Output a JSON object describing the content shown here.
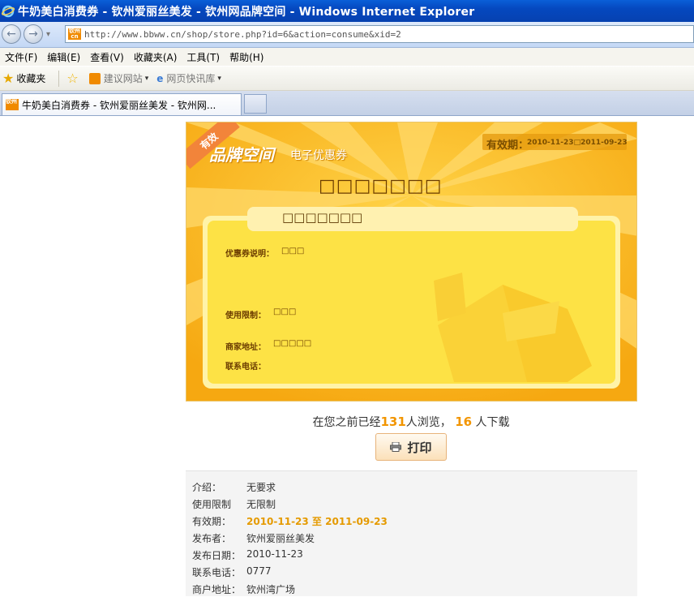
{
  "window": {
    "title": "牛奶美白消费券 - 钦州爱丽丝美发 - 钦州网品牌空间 - Windows Internet Explorer"
  },
  "address_bar": {
    "favicon_text": "钦州 cn",
    "url": "http://www.bbww.cn/shop/store.php?id=6&action=consume&xid=2"
  },
  "menu": {
    "items": [
      "文件(F)",
      "编辑(E)",
      "查看(V)",
      "收藏夹(A)",
      "工具(T)",
      "帮助(H)"
    ]
  },
  "favorites_bar": {
    "favorites_label": "收藏夹",
    "suggested_sites": "建议网站",
    "web_slice": "网页快讯库"
  },
  "tabs": [
    {
      "label": "牛奶美白消费券 - 钦州爱丽丝美发 - 钦州网..."
    }
  ],
  "coupon": {
    "badge": "有效",
    "brand": "品牌空间",
    "brand_sub": "电子优惠券",
    "valid_label": "有效期：",
    "valid_value": "2010-11-23□2011-09-23",
    "headline": "□□□□□□□",
    "sub_title": "□□□□□□□",
    "fields": [
      {
        "label": "优惠券说明：",
        "value": "□□□"
      },
      {
        "label": "使用限制：",
        "value": "□□□"
      },
      {
        "label": "商家地址：",
        "value": "□□□□□"
      },
      {
        "label": "联系电话：",
        "value": ""
      }
    ],
    "colors": {
      "bg": "#fbbd22",
      "panel": "#fde245",
      "ray": "#fdd763"
    }
  },
  "stats": {
    "prefix": "在您之前已经",
    "views": "131",
    "views_suffix": "人浏览，",
    "downloads": "16",
    "downloads_suffix": "人下载"
  },
  "print_button": {
    "label": "打印",
    "icon": "printer-icon"
  },
  "info": {
    "rows": [
      {
        "key": "介绍：",
        "value": "无要求"
      },
      {
        "key": "使用限制",
        "value": "无限制"
      },
      {
        "key": "有效期：",
        "value": "2010-11-23 至 2011-09-23"
      },
      {
        "key": "发布者：",
        "value": "钦州爱丽丝美发"
      },
      {
        "key": "发布日期：",
        "value": "2010-11-23"
      },
      {
        "key": "联系电话：",
        "value": "0777"
      },
      {
        "key": "商户地址：",
        "value": "钦州湾广场"
      }
    ]
  }
}
